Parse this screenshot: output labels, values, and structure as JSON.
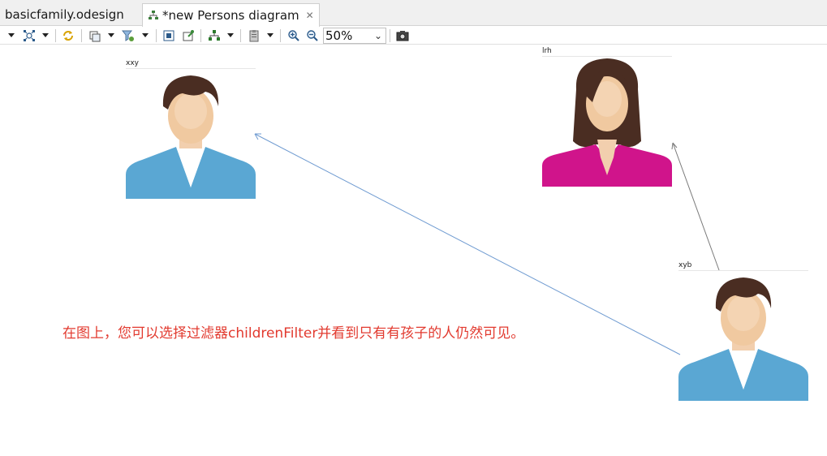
{
  "tabs": [
    {
      "label": "basicfamily.odesign",
      "active": false
    },
    {
      "label": "*new Persons diagram",
      "active": true
    }
  ],
  "toolbar": {
    "zoom_value": "50%"
  },
  "diagram": {
    "nodes": [
      {
        "label": "xxy",
        "kind": "male"
      },
      {
        "label": "lrh",
        "kind": "female"
      },
      {
        "label": "xyb",
        "kind": "male"
      }
    ],
    "edges": [
      {
        "from": "xyb",
        "to": "xxy",
        "color": "#6f9bd1"
      },
      {
        "from": "xyb",
        "to": "lrh",
        "color": "#7a7a7a"
      }
    ],
    "note": "在图上，您可以选择过滤器childrenFilter并看到只有有孩子的人仍然可见。"
  },
  "colors": {
    "shirt_male": "#5aa7d3",
    "shirt_female": "#d0148b",
    "hair": "#4a2d22",
    "skin": "#f0c9a0",
    "note_text": "#e23a2f"
  }
}
